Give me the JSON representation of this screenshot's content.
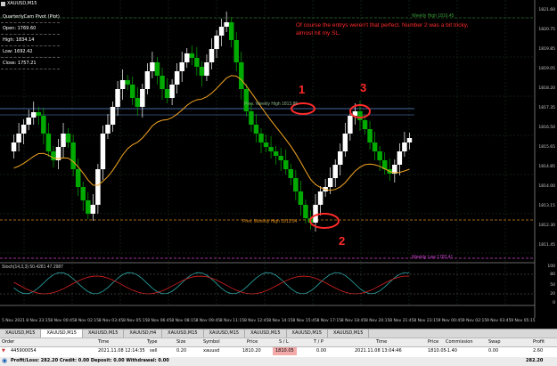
{
  "window": {
    "title": "XAUUSD,M15",
    "info_lines": [
      "QuarterlyCam Pivot (Plot)",
      "Open: 1769.60",
      "High: 1834.14",
      "Low: 1692.42",
      "Close: 1757.21"
    ]
  },
  "annotation_text": "Of course the entrys weren't that perfect. Number 2 was a bit tricky, almost hit my SL.",
  "markers": [
    "1",
    "2",
    "3"
  ],
  "levels": {
    "weekly_high": "Weekly High 1816.45",
    "prev_weekly_high": "Prev. Weekly High 1813.85",
    "prev_monthly_high": "Prev. Monthly High 1813.54",
    "weekly_low": "Weekly Low 1782.41"
  },
  "indicator_label": "Stoch(14,3,3) 50.4281 47.2987",
  "price_labels": [
    "1821.60",
    "1820.75",
    "1819.85",
    "1819.05",
    "1818.20",
    "1817.35",
    "1816.50",
    "1815.65",
    "1814.85",
    "1814.00",
    "1813.15",
    "1812.30",
    "1811.45",
    "100",
    "80",
    "50",
    "20",
    "0"
  ],
  "time_labels": [
    "5 Nov 2021",
    "8 Nov 23:15",
    "8 Nov 00:45",
    "8 Nov 02:15",
    "8 Nov 03:45",
    "8 Nov 05:15",
    "8 Nov 06:45",
    "8 Nov 08:15",
    "8 Nov 09:45",
    "8 Nov 11:15",
    "8 Nov 12:45",
    "8 Nov 14:15",
    "8 Nov 15:45",
    "8 Nov 17:15",
    "8 Nov 18:45",
    "8 Nov 20:15",
    "8 Nov 21:45",
    "8 Nov 23:15",
    "9 Nov 00:45",
    "9 Nov 02:15",
    "9 Nov 03:45",
    "9 Nov 05:15"
  ],
  "tabs": [
    "XAUUSD,M15",
    "XAUUSD,M15",
    "XAUUSD,M15",
    "XAUUSD,H4",
    "XAUUSD,M15",
    "XAUUSD,M15",
    "XAUUSD,M15",
    "XAUUSD,M15",
    "XAUUSD,M15"
  ],
  "terminal": {
    "headers": [
      "Order",
      "Time",
      "Type",
      "Size",
      "Symbol",
      "Price",
      "S / L",
      "T / P",
      "Time",
      "Price",
      "Commission",
      "Swap",
      "Profit"
    ],
    "row": [
      "445900054",
      "2021.11.08 12:14:35",
      "sell",
      "0.20",
      "xauusd",
      "1810.20",
      "1810.05",
      "0.00",
      "2021.11.08 13:04:46",
      "1810.05",
      "-1.40",
      "0.00",
      "2.60"
    ],
    "balance_line": "Profit/Loss: 282.20  Credit: 0.00  Deposit: 0.00  Withdrawal: 0.00",
    "balance_total": "282.20"
  },
  "colors": {
    "chart_bg": "#000000",
    "bull_candle": "#ffffff",
    "bear_candle": "#00aa00",
    "ma_line": "#f5a623",
    "annotation": "#ff2a2a",
    "level_blue": "#5b8bd6",
    "level_orange": "#d88a1a",
    "level_magenta": "#cc44cc"
  }
}
